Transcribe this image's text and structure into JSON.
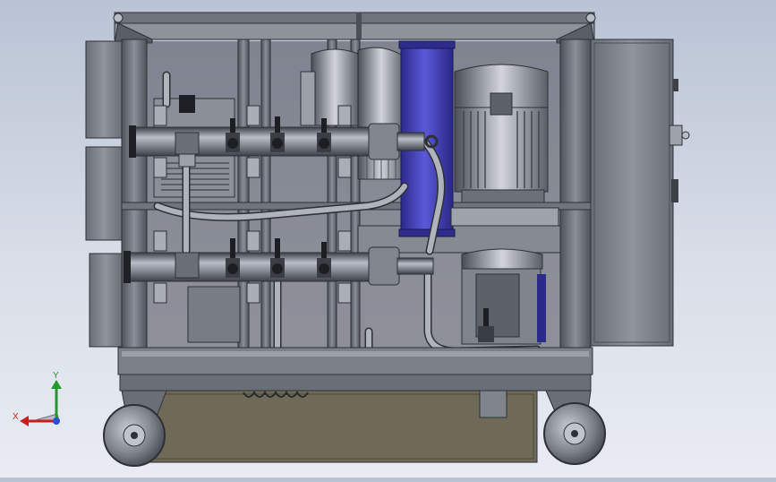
{
  "viewport": {
    "background_top": "#b9c3d4",
    "background_bottom": "#e9ecf2"
  },
  "model": {
    "frame_color": "#5d6169",
    "frame_dark": "#3a3d44",
    "steel_light": "#a6abb5",
    "filter_blue": "#3d3bb7",
    "base_khaki": "#6f6a58"
  },
  "triad": {
    "x_label": "X",
    "y_label": "Y",
    "x_color": "#cc1d1d",
    "y_color": "#1f9a2b",
    "z_color": "#2b4fd6"
  }
}
